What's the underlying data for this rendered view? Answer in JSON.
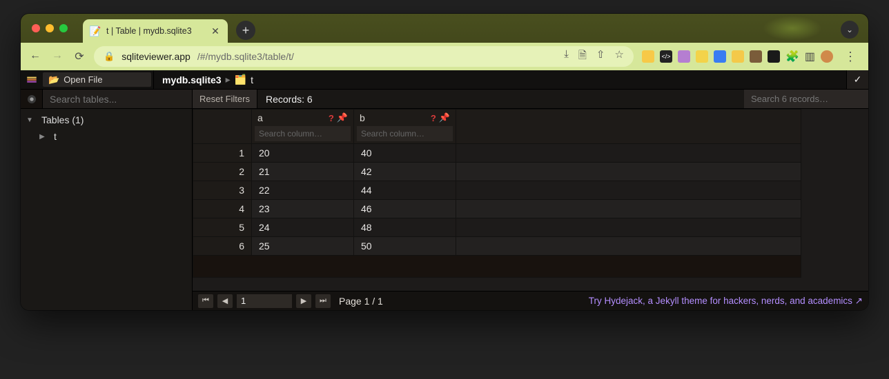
{
  "browser": {
    "tab_title": "t | Table | mydb.sqlite3",
    "url_host": "sqliteviewer.app",
    "url_path": "/#/mydb.sqlite3/table/t/"
  },
  "toolbar": {
    "open_file_label": "Open File",
    "breadcrumb_db": "mydb.sqlite3",
    "breadcrumb_table": "t"
  },
  "sidebar": {
    "search_placeholder": "Search tables...",
    "tables_header": "Tables (1)",
    "tables": [
      "t"
    ]
  },
  "filterbar": {
    "reset_label": "Reset Filters",
    "records_label": "Records: 6",
    "search_placeholder": "Search 6 records…"
  },
  "columns": [
    {
      "name": "a",
      "filter_placeholder": "Search column…"
    },
    {
      "name": "b",
      "filter_placeholder": "Search column…"
    }
  ],
  "rows": [
    {
      "n": 1,
      "a": "20",
      "b": "40"
    },
    {
      "n": 2,
      "a": "21",
      "b": "42"
    },
    {
      "n": 3,
      "a": "22",
      "b": "44"
    },
    {
      "n": 4,
      "a": "23",
      "b": "46"
    },
    {
      "n": 5,
      "a": "24",
      "b": "48"
    },
    {
      "n": 6,
      "a": "25",
      "b": "50"
    }
  ],
  "footer": {
    "page_input": "1",
    "page_text": "Page 1 / 1",
    "promo": "Try Hydejack, a Jekyll theme for hackers, nerds, and academics ↗"
  }
}
